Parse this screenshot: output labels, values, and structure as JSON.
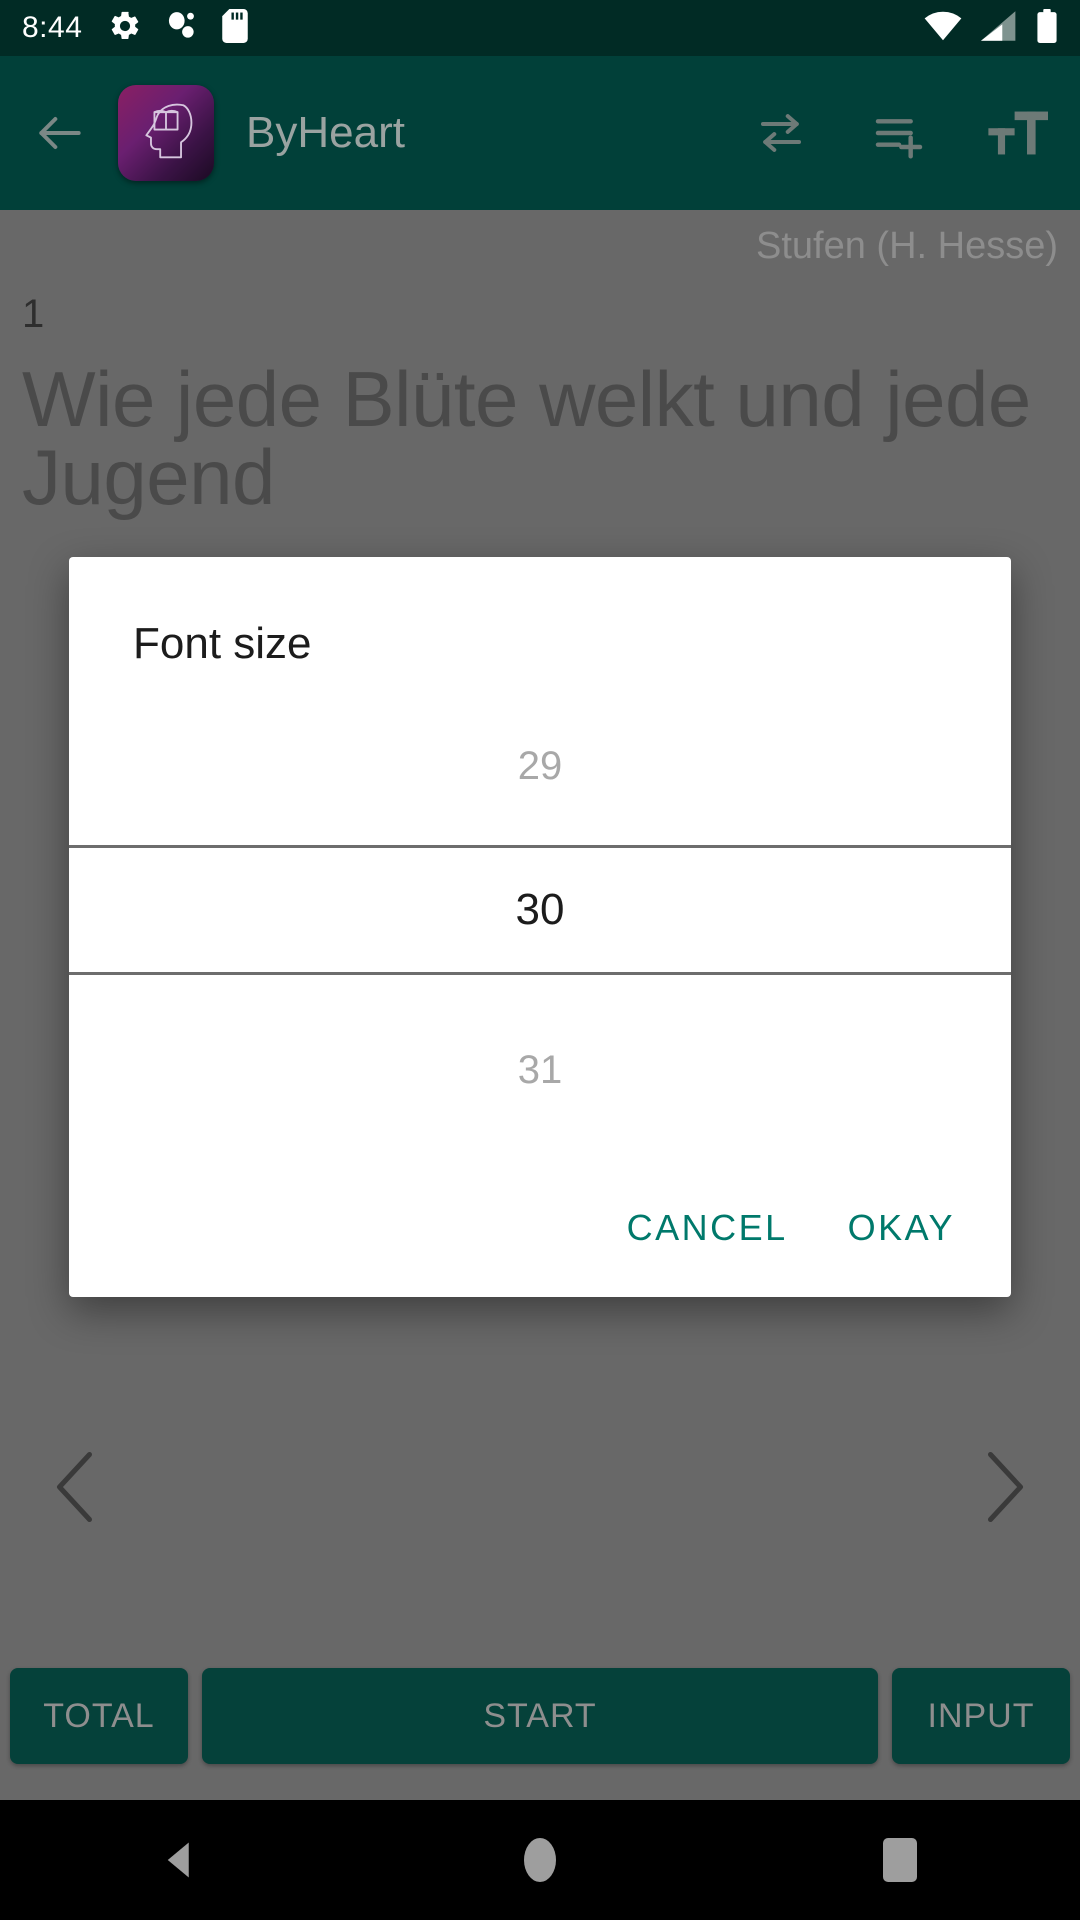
{
  "status_bar": {
    "clock": "8:44",
    "left_icons": [
      "gear-icon",
      "bubbles-icon",
      "sd-card-icon"
    ],
    "right_icons": [
      "wifi-icon",
      "cell-signal-icon",
      "battery-icon"
    ],
    "background_color": "#012B25"
  },
  "app_bar": {
    "back_icon": "back-arrow-icon",
    "logo_icon": "head-with-book-logo",
    "title": "ByHeart",
    "background_color": "#014039",
    "actions": [
      {
        "name": "swap-icon",
        "label": "Swap"
      },
      {
        "name": "playlist-add-icon",
        "label": "Add to list"
      },
      {
        "name": "format-size-icon",
        "label": "Font size"
      }
    ]
  },
  "content": {
    "source": "Stufen (H. Hesse)",
    "verse_number": "1",
    "verse_text": "Wie jede Blüte welkt und jede Jugend",
    "prev_icon": "chevron-left-icon",
    "next_icon": "chevron-right-icon",
    "bottom_buttons": [
      {
        "label": "TOTAL"
      },
      {
        "label": "START"
      },
      {
        "label": "INPUT"
      }
    ],
    "button_color": "#05413A"
  },
  "dialog": {
    "title": "Font size",
    "picker": {
      "previous_value": "29",
      "selected_value": "30",
      "next_value": "31"
    },
    "cancel_label": "CANCEL",
    "okay_label": "OKAY",
    "accent_color": "#00796B"
  },
  "nav_bar": {
    "back": "nav-back-icon",
    "home": "nav-home-icon",
    "recents": "nav-recents-icon"
  }
}
